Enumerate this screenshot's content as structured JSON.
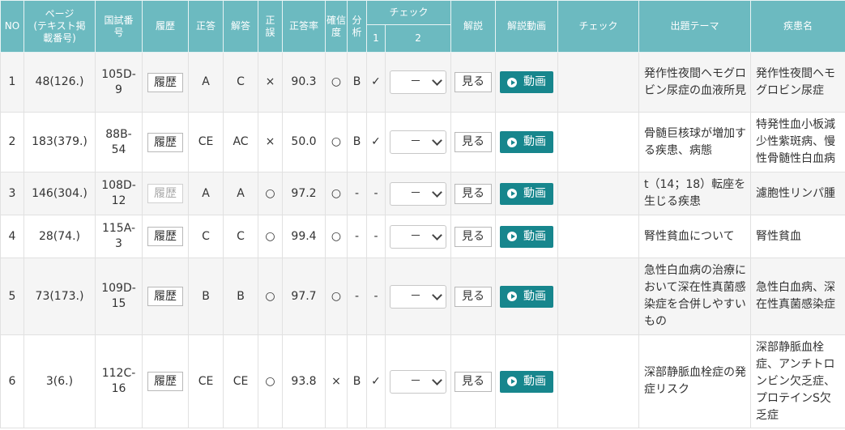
{
  "headers": {
    "no": "NO",
    "page": "ページ\n(テキスト掲\n載番号)",
    "exam": "国試番\n号",
    "history": "履歴",
    "correct": "正答",
    "answer": "解答",
    "right_wrong": "正\n誤",
    "rate": "正答率",
    "confidence": "確信\n度",
    "analysis": "分\n析",
    "check": "チェック",
    "check_1": "1",
    "check_2": "2",
    "explanation": "解説",
    "video": "解説動画",
    "check_col": "チェック",
    "theme": "出題テーマ",
    "disease": "疾患名"
  },
  "buttons": {
    "history": "履歴",
    "view": "見る",
    "video": "動画",
    "select_value": "－"
  },
  "rows": [
    {
      "no": "1",
      "page": "48(126.)",
      "exam": "105D-\n9",
      "history_enabled": true,
      "correct": "A",
      "answer": "C",
      "result": "×",
      "rate": "90.3",
      "confidence": "○",
      "analysis": "B",
      "check1": "✓",
      "theme": "発作性夜間ヘモグロビン尿症の血液所見",
      "disease": "発作性夜間ヘモグロビン尿症"
    },
    {
      "no": "2",
      "page": "183(379.)",
      "exam": "88B-\n54",
      "history_enabled": true,
      "correct": "CE",
      "answer": "AC",
      "result": "×",
      "rate": "50.0",
      "confidence": "○",
      "analysis": "B",
      "check1": "✓",
      "theme": "骨髄巨核球が増加する疾患、病態",
      "disease": "特発性血小板減少性紫斑病、慢性骨髄性白血病"
    },
    {
      "no": "3",
      "page": "146(304.)",
      "exam": "108D-\n12",
      "history_enabled": false,
      "correct": "A",
      "answer": "A",
      "result": "○",
      "rate": "97.2",
      "confidence": "○",
      "analysis": "-",
      "check1": "-",
      "theme": "t（14；18）転座を生じる疾患",
      "disease": "濾胞性リンパ腫"
    },
    {
      "no": "4",
      "page": "28(74.)",
      "exam": "115A-\n3",
      "history_enabled": true,
      "correct": "C",
      "answer": "C",
      "result": "○",
      "rate": "99.4",
      "confidence": "○",
      "analysis": "-",
      "check1": "-",
      "theme": "腎性貧血について",
      "disease": "腎性貧血"
    },
    {
      "no": "5",
      "page": "73(173.)",
      "exam": "109D-\n15",
      "history_enabled": true,
      "correct": "B",
      "answer": "B",
      "result": "○",
      "rate": "97.7",
      "confidence": "○",
      "analysis": "-",
      "check1": "-",
      "theme": "急性白血病の治療において深在性真菌感染症を合併しやすいもの",
      "disease": "急性白血病、深在性真菌感染症"
    },
    {
      "no": "6",
      "page": "3(6.)",
      "exam": "112C-\n16",
      "history_enabled": true,
      "correct": "CE",
      "answer": "CE",
      "result": "○",
      "rate": "93.8",
      "confidence": "×",
      "analysis": "B",
      "check1": "✓",
      "theme": "深部静脈血栓症の発症リスク",
      "disease": "深部静脈血栓症、アンチトロンビン欠乏症、プロテインS欠乏症"
    }
  ]
}
